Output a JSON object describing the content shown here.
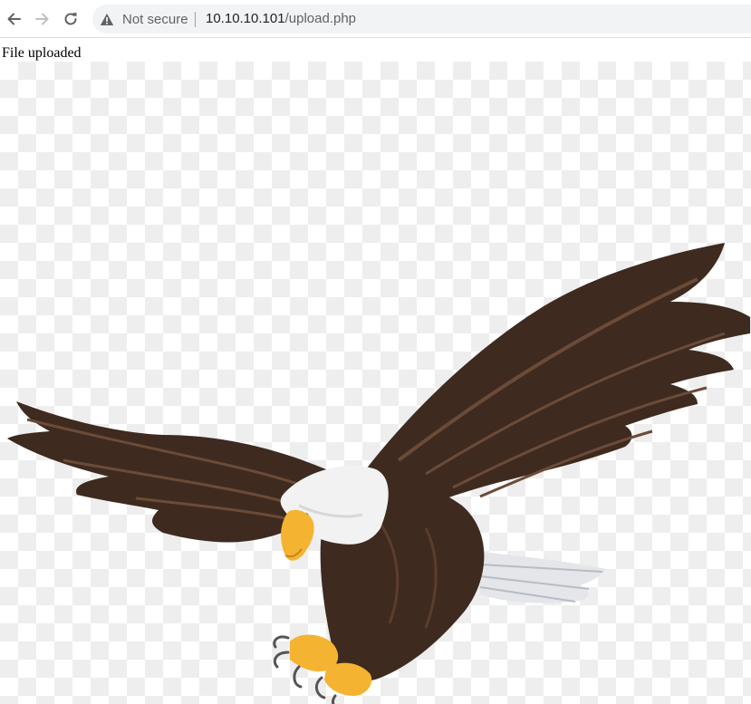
{
  "browser": {
    "security_label": "Not secure",
    "url_host": "10.10.10.101",
    "url_path": "/upload.php",
    "icons": {
      "back": "arrow-left-icon",
      "forward": "arrow-right-icon",
      "reload": "reload-icon",
      "security": "warning-triangle-icon"
    }
  },
  "page": {
    "message": "File uploaded",
    "image_subject": "eagle"
  },
  "colors": {
    "toolbar_bg": "#ffffff",
    "omnibox_bg": "#f1f3f4",
    "eagle_body": "#3e2a1f",
    "eagle_head": "#f2f2f2",
    "eagle_beak": "#f5b332"
  }
}
